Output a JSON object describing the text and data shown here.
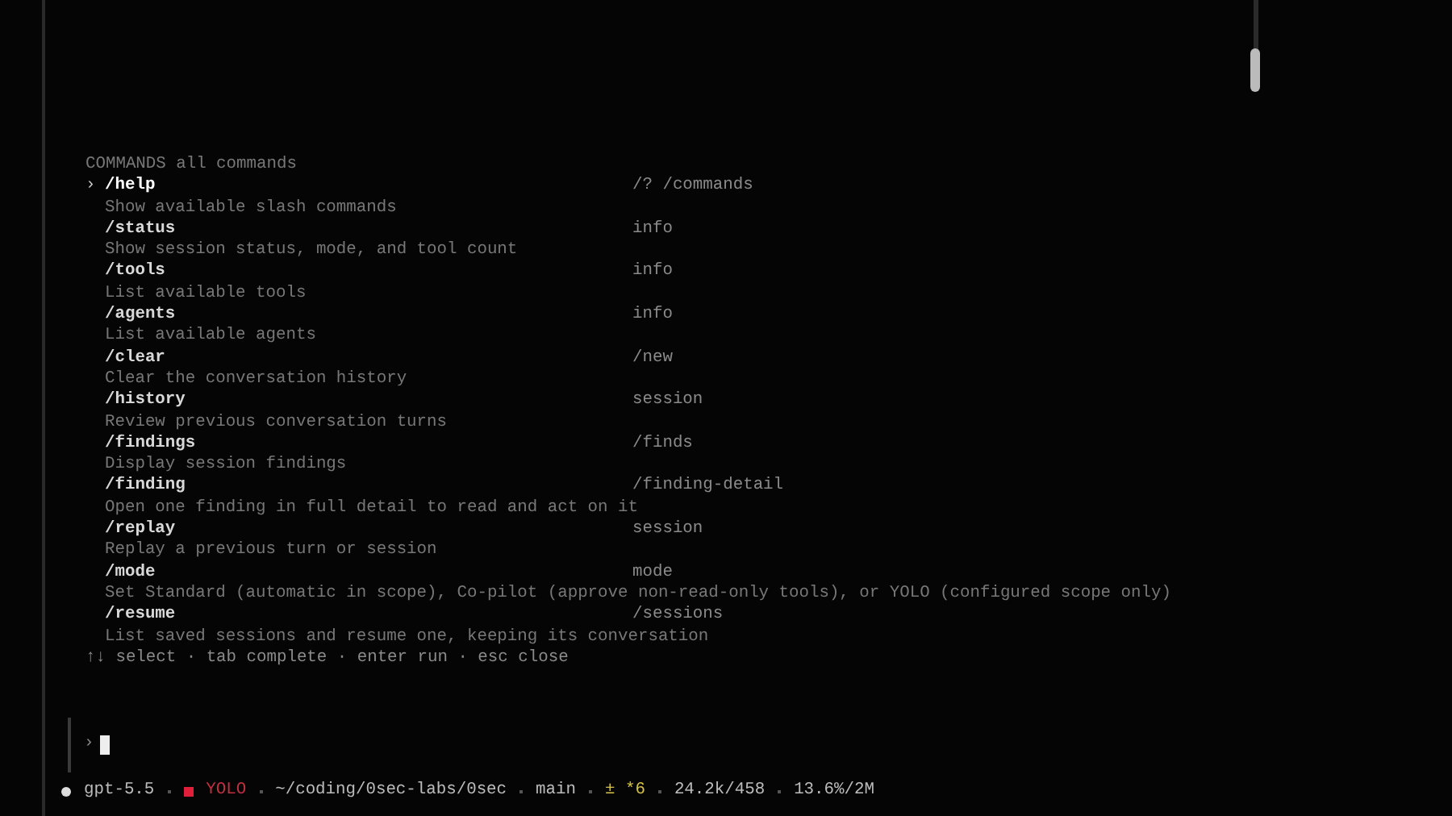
{
  "palette": {
    "heading": "COMMANDS",
    "subheading": "all commands",
    "commands": [
      {
        "name": "/help",
        "alias": "/? /commands",
        "description": "Show available slash commands",
        "selected": true
      },
      {
        "name": "/status",
        "alias": "info",
        "description": "Show session status, mode, and tool count",
        "selected": false
      },
      {
        "name": "/tools",
        "alias": "info",
        "description": "List available tools",
        "selected": false
      },
      {
        "name": "/agents",
        "alias": "info",
        "description": "List available agents",
        "selected": false
      },
      {
        "name": "/clear",
        "alias": "/new",
        "description": "Clear the conversation history",
        "selected": false
      },
      {
        "name": "/history",
        "alias": "session",
        "description": "Review previous conversation turns",
        "selected": false
      },
      {
        "name": "/findings",
        "alias": "/finds",
        "description": "Display session findings",
        "selected": false
      },
      {
        "name": "/finding",
        "alias": "/finding-detail",
        "description": "Open one finding in full detail to read and act on it",
        "selected": false
      },
      {
        "name": "/replay",
        "alias": "session",
        "description": "Replay a previous turn or session",
        "selected": false
      },
      {
        "name": "/mode",
        "alias": "mode",
        "description": "Set Standard (automatic in scope), Co-pilot (approve non-read-only tools), or YOLO (configured scope only)",
        "selected": false
      },
      {
        "name": "/resume",
        "alias": "/sessions",
        "description": "List saved sessions and resume one, keeping its conversation",
        "selected": false
      }
    ],
    "hint": "↑↓ select · tab complete · enter run · esc close",
    "marker": "›"
  },
  "prompt": {
    "symbol": "›"
  },
  "status_bar": {
    "model": "gpt-5.5",
    "mode": "YOLO",
    "path": "~/coding/0sec-labs/0sec",
    "branch": "main",
    "changes": "± *6",
    "tokens": "24.2k/458",
    "context": "13.6%/2M"
  }
}
